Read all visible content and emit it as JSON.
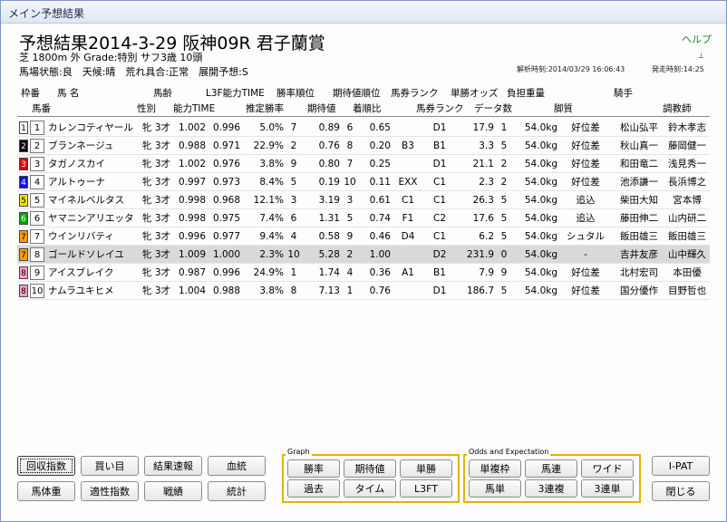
{
  "window": {
    "title": "メイン予想結果",
    "help": "ヘルプ",
    "pin_icon": "pin-icon"
  },
  "race": {
    "title": "予想結果2014-3-29 阪神09R 君子蘭賞",
    "line1": "芝 1800m 外 Grade:特別 サフ3歳 10頭",
    "line2": "馬場状態:良　天候:晴　荒れ具合:正常　展開予想:S",
    "analysis_time": "解析時刻:2014/03/29 16:06:43",
    "start_time": "発走時刻:14:25"
  },
  "headers": {
    "row1": {
      "waku": "枠番",
      "name": "馬 名",
      "age": "馬齢",
      "l3f": "L3F能力TIME",
      "prob_rank": "勝率順位",
      "exp_rank": "期待値順位",
      "bet_rank": "馬券ランク",
      "win_odds": "単勝オッズ",
      "weight": "負担重量",
      "jockey": "騎手"
    },
    "row2": {
      "umaban": "馬番",
      "sex": "性別",
      "ability": "能力TIME",
      "est_prob": "推定勝率",
      "exp_val": "期待値",
      "finish": "着順比",
      "bet_rank2": "馬券ランク",
      "data_count": "データ数",
      "leg": "脚質",
      "trainer": "調教師"
    }
  },
  "frame_colors": [
    "#ffffff",
    "#000000",
    "#e00000",
    "#1010e0",
    "#f5e600",
    "#10a010",
    "#ff9a00",
    "#ff9ec8"
  ],
  "horses": [
    {
      "waku": "1",
      "num": "1",
      "name": "カレンコティヤール",
      "sexage": "牝 3才",
      "t1": "1.002",
      "t2": "0.996",
      "prob": "5.0%",
      "prank": "7",
      "exp": "0.89",
      "erank": "6",
      "ratio": "0.65",
      "mark": "",
      "rank": "D1",
      "odds": "17.9",
      "dc": "1",
      "wt": "54.0kg",
      "style": "好位差",
      "jockey": "松山弘平",
      "trainer": "鈴木孝志"
    },
    {
      "waku": "2",
      "num": "2",
      "name": "ブランネージュ",
      "sexage": "牝 3才",
      "t1": "0.988",
      "t2": "0.971",
      "prob": "22.9%",
      "prank": "2",
      "exp": "0.76",
      "erank": "8",
      "ratio": "0.20",
      "mark": "B3",
      "rank": "B1",
      "odds": "3.3",
      "dc": "5",
      "wt": "54.0kg",
      "style": "好位差",
      "jockey": "秋山真一",
      "trainer": "藤岡健一"
    },
    {
      "waku": "3",
      "num": "3",
      "name": "タガノスカイ",
      "sexage": "牝 3才",
      "t1": "1.002",
      "t2": "0.976",
      "prob": "3.8%",
      "prank": "9",
      "exp": "0.80",
      "erank": "7",
      "ratio": "0.25",
      "mark": "",
      "rank": "D1",
      "odds": "21.1",
      "dc": "2",
      "wt": "54.0kg",
      "style": "好位差",
      "jockey": "和田竜二",
      "trainer": "浅見秀一"
    },
    {
      "waku": "4",
      "num": "4",
      "name": "アルトゥーナ",
      "sexage": "牝 3才",
      "t1": "0.997",
      "t2": "0.973",
      "prob": "8.4%",
      "prank": "5",
      "exp": "0.19",
      "erank": "10",
      "ratio": "0.11",
      "mark": "EXX",
      "rank": "C1",
      "odds": "2.3",
      "dc": "2",
      "wt": "54.0kg",
      "style": "好位差",
      "jockey": "池添謙一",
      "trainer": "長浜博之"
    },
    {
      "waku": "5",
      "num": "5",
      "name": "マイネルベルタス",
      "sexage": "牝 3才",
      "t1": "0.998",
      "t2": "0.968",
      "prob": "12.1%",
      "prank": "3",
      "exp": "3.19",
      "erank": "3",
      "ratio": "0.61",
      "mark": "C1",
      "rank": "C1",
      "odds": "26.3",
      "dc": "5",
      "wt": "54.0kg",
      "style": "追込",
      "jockey": "柴田大知",
      "trainer": "宮本博"
    },
    {
      "waku": "6",
      "num": "6",
      "name": "ヤマニンアリエッタ",
      "sexage": "牝 3才",
      "t1": "0.998",
      "t2": "0.975",
      "prob": "7.4%",
      "prank": "6",
      "exp": "1.31",
      "erank": "5",
      "ratio": "0.74",
      "mark": "F1",
      "rank": "C2",
      "odds": "17.6",
      "dc": "5",
      "wt": "54.0kg",
      "style": "追込",
      "jockey": "藤田伸二",
      "trainer": "山内研二"
    },
    {
      "waku": "7",
      "num": "7",
      "name": "ウインリバティ",
      "sexage": "牝 3才",
      "t1": "0.996",
      "t2": "0.977",
      "prob": "9.4%",
      "prank": "4",
      "exp": "0.58",
      "erank": "9",
      "ratio": "0.46",
      "mark": "D4",
      "rank": "C1",
      "odds": "6.2",
      "dc": "5",
      "wt": "54.0kg",
      "style": "シュタル",
      "jockey": "飯田雄三",
      "trainer": "飯田雄三"
    },
    {
      "waku": "7",
      "num": "8",
      "name": "ゴールドソレイユ",
      "sexage": "牝 3才",
      "t1": "1.009",
      "t2": "1.000",
      "prob": "2.3%",
      "prank": "10",
      "exp": "5.28",
      "erank": "2",
      "ratio": "1.00",
      "mark": "",
      "rank": "D2",
      "odds": "231.9",
      "dc": "0",
      "wt": "54.0kg",
      "style": "-",
      "jockey": "吉井友彦",
      "trainer": "山中輝久",
      "selected": true
    },
    {
      "waku": "8",
      "num": "9",
      "name": "アイスブレイク",
      "sexage": "牝 3才",
      "t1": "0.987",
      "t2": "0.996",
      "prob": "24.9%",
      "prank": "1",
      "exp": "1.74",
      "erank": "4",
      "ratio": "0.36",
      "mark": "A1",
      "rank": "B1",
      "odds": "7.9",
      "dc": "9",
      "wt": "54.0kg",
      "style": "好位差",
      "jockey": "北村宏司",
      "trainer": "本田優"
    },
    {
      "waku": "8",
      "num": "10",
      "name": "ナムラユキヒメ",
      "sexage": "牝 3才",
      "t1": "1.004",
      "t2": "0.988",
      "prob": "3.8%",
      "prank": "8",
      "exp": "7.13",
      "erank": "1",
      "ratio": "0.76",
      "mark": "",
      "rank": "D1",
      "odds": "186.7",
      "dc": "5",
      "wt": "54.0kg",
      "style": "好位差",
      "jockey": "国分優作",
      "trainer": "目野哲也"
    }
  ],
  "buttons": {
    "recovery": "回収指数",
    "kaime": "買い目",
    "result_flash": "結果速報",
    "bloodline": "血統",
    "weight": "馬体重",
    "aptitude": "適性指数",
    "record": "戦績",
    "stats": "統計",
    "ipat": "I-PAT",
    "close": "閉じる"
  },
  "graph": {
    "label": "Graph",
    "buttons": [
      "勝率",
      "期待値",
      "単勝",
      "過去",
      "タイム",
      "L3FT"
    ]
  },
  "odds": {
    "label": "Odds and Expectation",
    "buttons": [
      "単複枠",
      "馬連",
      "ワイド",
      "馬単",
      "3連複",
      "3連単"
    ]
  }
}
